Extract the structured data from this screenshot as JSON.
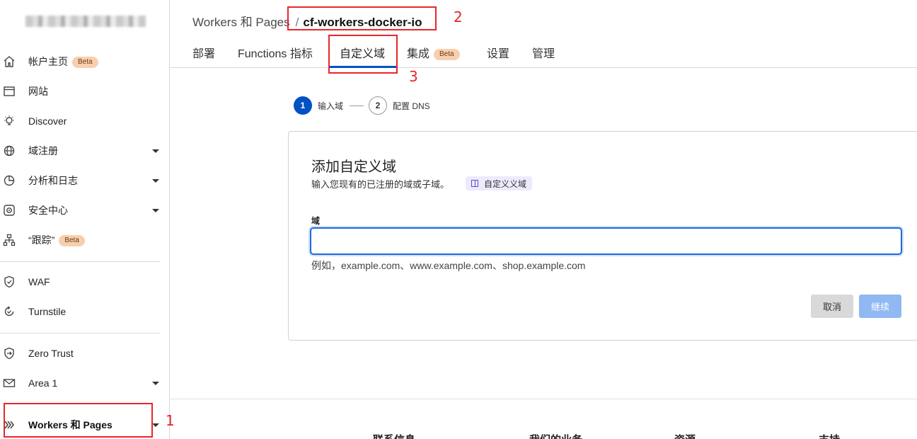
{
  "sidebar": {
    "items": [
      {
        "label": "帐户主页",
        "badge": "Beta",
        "icon": "home-icon"
      },
      {
        "label": "网站",
        "icon": "window-icon"
      },
      {
        "label": "Discover",
        "icon": "lightbulb-icon"
      },
      {
        "label": "域注册",
        "icon": "globe-icon",
        "caret": true
      },
      {
        "label": "分析和日志",
        "icon": "pie-chart-icon",
        "caret": true
      },
      {
        "label": "安全中心",
        "icon": "security-center-icon",
        "caret": true
      },
      {
        "label": "“跟踪”",
        "badge": "Beta",
        "icon": "sitemap-icon"
      },
      {
        "label": "WAF",
        "icon": "shield-icon"
      },
      {
        "label": "Turnstile",
        "icon": "turnstile-icon"
      },
      {
        "label": "Zero Trust",
        "icon": "zero-trust-icon"
      },
      {
        "label": "Area 1",
        "icon": "envelope-icon",
        "caret": true
      },
      {
        "label": "Workers 和 Pages",
        "icon": "workers-icon",
        "caret": true
      }
    ]
  },
  "header": {
    "breadcrumb_parent": "Workers 和 Pages",
    "breadcrumb_sep": "/",
    "breadcrumb_current": "cf-workers-docker-io"
  },
  "tabs": {
    "deploy": "部署",
    "metrics": "Functions 指标",
    "custom_domain": "自定义域",
    "integrations": "集成",
    "integrations_badge": "Beta",
    "settings": "设置",
    "manage": "管理"
  },
  "stepper": {
    "step1_num": "1",
    "step1_label": "输入域",
    "step2_num": "2",
    "step2_label": "配置 DNS"
  },
  "card": {
    "title": "添加自定义域",
    "subtitle": "输入您现有的已注册的域或子域。",
    "doc_link": "自定义义域",
    "field_label": "域",
    "field_value": "",
    "help": "例如，example.com、www.example.com、shop.example.com",
    "cancel": "取消",
    "continue": "继续"
  },
  "footer": {
    "col1": "联系信息",
    "col2": "我们的业务",
    "col3": "资源",
    "col4": "支持"
  },
  "annotations": {
    "n1": "1",
    "n2": "2",
    "n3": "3"
  },
  "colors": {
    "accent": "#0051c3",
    "annotation": "#e8262a",
    "beta_bg": "#f8cfae"
  }
}
